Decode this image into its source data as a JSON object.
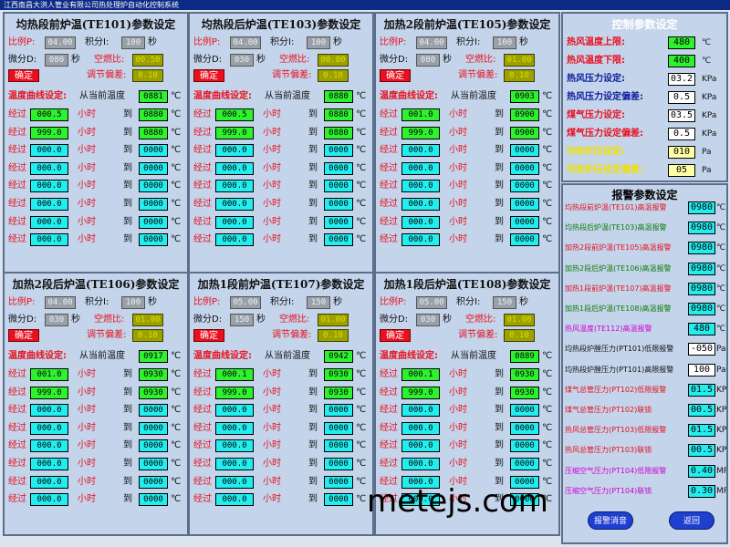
{
  "window_title": "江西南昌大洪人管业有限公司热处理炉自动化控制系统",
  "labels": {
    "p": "比例P:",
    "i": "积分I:",
    "d": "微分D:",
    "sec": "秒",
    "air_ratio": "空燃比:",
    "confirm": "确定",
    "deviation": "调节偏差:",
    "curve": "温度曲线设定:",
    "from_current": "从当前温度",
    "pass": "经过",
    "hours": "小时",
    "to": "到",
    "celsius": "℃"
  },
  "panels": [
    {
      "title": "均热段前炉温(TE101)参数设定",
      "p": "04.00",
      "i": "100",
      "d": "080",
      "air_ratio": "00.50",
      "deviation": "0.10",
      "current_temp": "0881",
      "rows": [
        [
          "000.5",
          "0880"
        ],
        [
          "999.0",
          "0880"
        ],
        [
          "000.0",
          "0000"
        ],
        [
          "000.0",
          "0000"
        ],
        [
          "000.0",
          "0000"
        ],
        [
          "000.0",
          "0000"
        ],
        [
          "000.0",
          "0000"
        ],
        [
          "000.0",
          "0000"
        ]
      ]
    },
    {
      "title": "均热段后炉温(TE103)参数设定",
      "p": "04.00",
      "i": "100",
      "d": "030",
      "air_ratio": "00.80",
      "deviation": "0.10",
      "current_temp": "0880",
      "rows": [
        [
          "000.5",
          "0880"
        ],
        [
          "999.0",
          "0880"
        ],
        [
          "000.0",
          "0000"
        ],
        [
          "000.0",
          "0000"
        ],
        [
          "000.0",
          "0000"
        ],
        [
          "000.0",
          "0000"
        ],
        [
          "000.0",
          "0000"
        ],
        [
          "000.0",
          "0000"
        ]
      ]
    },
    {
      "title": "加热2段前炉温(TE105)参数设定",
      "p": "04.00",
      "i": "100",
      "d": "080",
      "air_ratio": "01.00",
      "deviation": "0.10",
      "current_temp": "0903",
      "rows": [
        [
          "001.0",
          "0900"
        ],
        [
          "999.0",
          "0900"
        ],
        [
          "000.0",
          "0000"
        ],
        [
          "000.0",
          "0000"
        ],
        [
          "000.0",
          "0000"
        ],
        [
          "000.0",
          "0000"
        ],
        [
          "000.0",
          "0000"
        ],
        [
          "000.0",
          "0000"
        ]
      ]
    },
    {
      "title": "加热2段后炉温(TE106)参数设定",
      "p": "04.00",
      "i": "100",
      "d": "030",
      "air_ratio": "01.00",
      "deviation": "0.10",
      "current_temp": "0917",
      "rows": [
        [
          "001.0",
          "0930"
        ],
        [
          "999.0",
          "0930"
        ],
        [
          "000.0",
          "0000"
        ],
        [
          "000.0",
          "0000"
        ],
        [
          "000.0",
          "0000"
        ],
        [
          "000.0",
          "0000"
        ],
        [
          "000.0",
          "0000"
        ],
        [
          "000.0",
          "0000"
        ]
      ]
    },
    {
      "title": "加热1段前炉温(TE107)参数设定",
      "p": "05.00",
      "i": "150",
      "d": "150",
      "air_ratio": "01.00",
      "deviation": "0.10",
      "current_temp": "0942",
      "rows": [
        [
          "000.1",
          "0930"
        ],
        [
          "999.0",
          "0930"
        ],
        [
          "000.0",
          "0000"
        ],
        [
          "000.0",
          "0000"
        ],
        [
          "000.0",
          "0000"
        ],
        [
          "000.0",
          "0000"
        ],
        [
          "000.0",
          "0000"
        ],
        [
          "000.0",
          "0000"
        ]
      ]
    },
    {
      "title": "加热1段后炉温(TE108)参数设定",
      "p": "05.00",
      "i": "150",
      "d": "030",
      "air_ratio": "01.00",
      "deviation": "0.10",
      "current_temp": "0889",
      "rows": [
        [
          "000.1",
          "0930"
        ],
        [
          "999.0",
          "0930"
        ],
        [
          "000.0",
          "0000"
        ],
        [
          "000.0",
          "0000"
        ],
        [
          "000.0",
          "0000"
        ],
        [
          "000.0",
          "0000"
        ],
        [
          "000.0",
          "0000"
        ],
        [
          "000.0",
          "0000"
        ]
      ]
    }
  ],
  "control": {
    "title": "控制参数设定",
    "items": [
      {
        "label": "热风温度上限:",
        "value": "480",
        "unit": "℃",
        "color": "red",
        "box": "green"
      },
      {
        "label": "热风温度下限:",
        "value": "400",
        "unit": "℃",
        "color": "red",
        "box": "green"
      },
      {
        "label": "热风压力设定:",
        "value": "03.2",
        "unit": "KPa",
        "color": "blue",
        "box": "white"
      },
      {
        "label": "热风压力设定偏差:",
        "value": "0.5",
        "unit": "KPa",
        "color": "blue",
        "box": "white"
      },
      {
        "label": "煤气压力设定:",
        "value": "03.5",
        "unit": "KPa",
        "color": "red",
        "box": "white"
      },
      {
        "label": "煤气压力设定偏差:",
        "value": "0.5",
        "unit": "KPa",
        "color": "red",
        "box": "white"
      },
      {
        "label": "均热炉压设定:",
        "value": "010",
        "unit": "Pa",
        "color": "yellow",
        "box": "yellow"
      },
      {
        "label": "均热炉压设定偏差:",
        "value": "05",
        "unit": "Pa",
        "color": "yellow",
        "box": "yellow"
      }
    ]
  },
  "alarm": {
    "title": "报警参数设定",
    "items": [
      {
        "label": "均热段前炉温(TE101)高温报警",
        "value": "0980",
        "unit": "℃",
        "color": "red",
        "box": "cyan"
      },
      {
        "label": "均热段后炉温(TE103)高温报警",
        "value": "0980",
        "unit": "℃",
        "color": "green",
        "box": "cyan"
      },
      {
        "label": "加热2段前炉温(TE105)高温报警",
        "value": "0980",
        "unit": "℃",
        "color": "red",
        "box": "cyan"
      },
      {
        "label": "加热2段后炉温(TE106)高温报警",
        "value": "0980",
        "unit": "℃",
        "color": "green",
        "box": "cyan"
      },
      {
        "label": "加热1段前炉温(TE107)高温报警",
        "value": "0980",
        "unit": "℃",
        "color": "red",
        "box": "cyan"
      },
      {
        "label": "加热1段后炉温(TE108)高温报警",
        "value": "0980",
        "unit": "℃",
        "color": "green",
        "box": "cyan"
      },
      {
        "label": "热风温度(TE112)高温报警",
        "value": "480",
        "unit": "℃",
        "color": "magenta",
        "box": "cyan"
      },
      {
        "label": "均热段炉膛压力(PT101)低限报警",
        "value": "-050",
        "unit": "Pa",
        "color": "black",
        "box": "white"
      },
      {
        "label": "均热段炉膛压力(PT101)高限报警",
        "value": "100",
        "unit": "Pa",
        "color": "black",
        "box": "white"
      },
      {
        "label": "煤气总管压力(PT102)低限报警",
        "value": "01.5",
        "unit": "KPa",
        "color": "red",
        "box": "cyan"
      },
      {
        "label": "煤气总管压力(PT102)联锁",
        "value": "00.5",
        "unit": "KPa",
        "color": "red",
        "box": "cyan"
      },
      {
        "label": "热风总管压力(PT103)低限报警",
        "value": "01.5",
        "unit": "KPa",
        "color": "red",
        "box": "cyan"
      },
      {
        "label": "热风总管压力(PT103)联锁",
        "value": "00.5",
        "unit": "KPa",
        "color": "red",
        "box": "cyan"
      },
      {
        "label": "压缩空气压力(PT104)低限报警",
        "value": "0.40",
        "unit": "MPa",
        "color": "magenta",
        "box": "cyan"
      },
      {
        "label": "压缩空气压力(PT104)联锁",
        "value": "0.30",
        "unit": "MPa",
        "color": "magenta",
        "box": "cyan"
      }
    ]
  },
  "buttons": {
    "alarm_mute": "报警消音",
    "back": "返回"
  },
  "watermark": "metejs.com"
}
